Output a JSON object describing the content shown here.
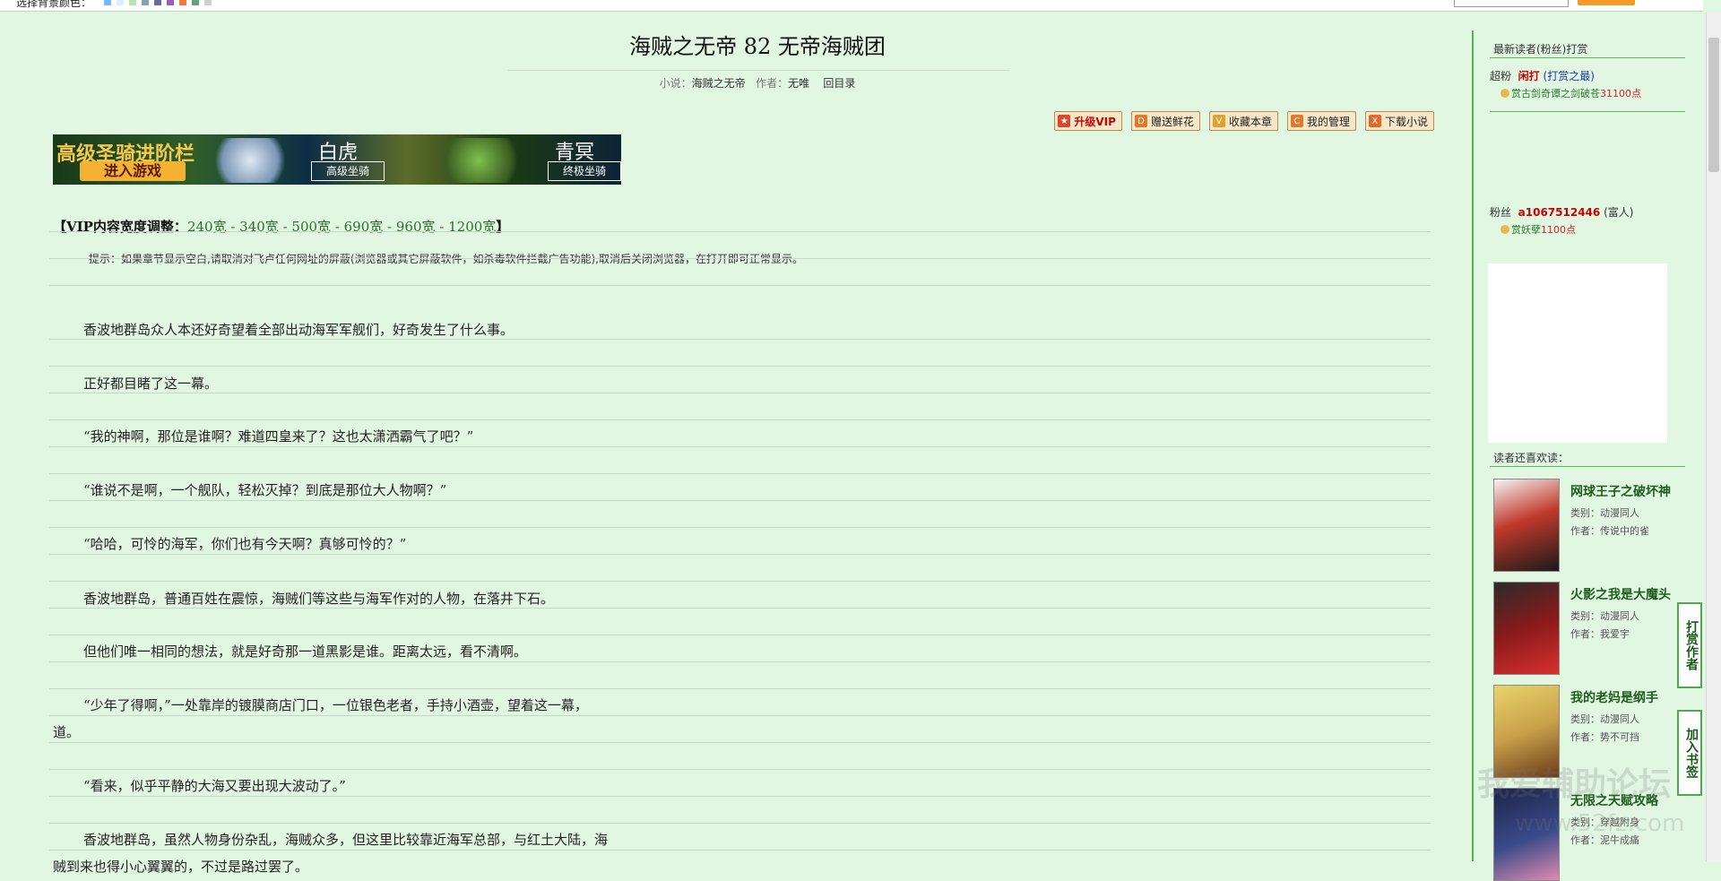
{
  "topbar": {
    "label": "选择背景颜色：",
    "swatches": [
      "#74b8ff",
      "#d7eeff",
      "#b7e3b7",
      "#8aa1b5",
      "#6b6b9a",
      "#9a60b8",
      "#f07a3a",
      "#68a07a",
      "#cfcfcf"
    ]
  },
  "chapter": {
    "title": "海贼之无帝  82  无帝海贼团",
    "novel_label": "小说：",
    "novel": "海贼之无帝",
    "author_label": "作者：",
    "author": "无唯",
    "back": "回目录"
  },
  "actions": [
    {
      "label": "升级VIP",
      "icon": "vip-icon"
    },
    {
      "label": "赠送鲜花",
      "icon": "flower-icon"
    },
    {
      "label": "收藏本章",
      "icon": "bookmark-icon"
    },
    {
      "label": "我的管理",
      "icon": "manage-icon"
    },
    {
      "label": "下载小说",
      "icon": "download-icon"
    }
  ],
  "banner": {
    "left_title": "高级圣骑进阶栏",
    "enter": "进入游戏",
    "tiger": "白虎",
    "tiger_btn": "高级坐骑",
    "azure": "青冥",
    "azure_btn": "终极坐骑"
  },
  "vip_width": {
    "prefix": "【VIP内容宽度调整：",
    "options": "240宽 - 340宽 - 500宽 - 690宽 - 960宽 - 1200宽",
    "suffix": "】"
  },
  "tip": "提示：如果章节显示空白,请取消对飞卢任何网址的屏蔽(浏览器或其它屏蔽软件，如杀毒软件拦截广告功能),取消后关闭浏览器，在打开即可正常显示。",
  "paragraphs": [
    "香波地群岛众人本还好奇望着全部出动海军军舰们，好奇发生了什么事。",
    "正好都目睹了这一幕。",
    "“我的神啊，那位是谁啊？难道四皇来了？这也太潇洒霸气了吧？”",
    "“谁说不是啊，一个舰队，轻松灭掉？到底是那位大人物啊？”",
    "“哈哈，可怜的海军，你们也有今天啊？真够可怜的？”",
    "香波地群岛，普通百姓在震惊，海贼们等这些与海军作对的人物，在落井下石。",
    "但他们唯一相同的想法，就是好奇那一道黑影是谁。距离太远，看不清啊。",
    "“少年了得啊，”一处靠岸的镀膜商店门口，一位银色老者，手持小酒壶，望着这一幕，",
    "道。",
    "“看来，似乎平静的大海又要出现大波动了。”",
    "香波地群岛，虽然人物身份杂乱，海贼众多，但这里比较靠近海军总部，与红土大陆，海",
    "贼到来也得小心翼翼的，不过是路过罢了。"
  ],
  "sidebar": {
    "head": "最新读者(粉丝)打赏",
    "fan1": {
      "rank": "超粉",
      "name": "闲打",
      "link": "打赏之最",
      "gift_prefix": "赏",
      "gift_item": "古剑奇谭之剑破苍",
      "gift_points": "31100点"
    },
    "fan2": {
      "rank": "粉丝",
      "name": "a1067512446",
      "tag": "富人",
      "gift_prefix": "赏",
      "gift_item": "妖孽",
      "gift_points": "1100点"
    },
    "also": "读者还喜欢读：",
    "books": [
      {
        "title": "网球王子之破坏神",
        "cat": "类别：动漫同人",
        "author": "作者：传说中的雀"
      },
      {
        "title": "火影之我是大魔头",
        "cat": "类别：动漫同人",
        "author": "作者：我爱宇"
      },
      {
        "title": "我的老妈是纲手",
        "cat": "类别：动漫同人",
        "author": "作者：势不可挡"
      },
      {
        "title": "无限之天赋攻略",
        "cat": "类别：穿越附身",
        "author": "作者：泥牛成痛"
      }
    ],
    "tab_tip": "打赏作者",
    "tab_bookmark": "加入书签"
  },
  "watermark": {
    "line1": "我爱辅助论坛",
    "line2": "www.52fz.com"
  }
}
